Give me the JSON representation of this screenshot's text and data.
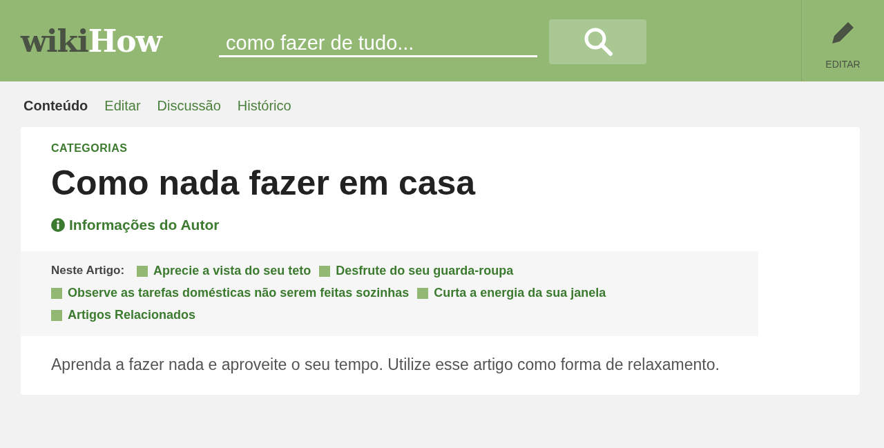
{
  "header": {
    "logo": {
      "part_1": "wiki",
      "part_2": "How"
    },
    "search": {
      "placeholder": "como fazer de tudo..."
    },
    "edit_button": {
      "label": "EDITAR"
    }
  },
  "tabs": [
    {
      "label": "Conteúdo",
      "selected": true
    },
    {
      "label": "Editar",
      "selected": false
    },
    {
      "label": "Discussão",
      "selected": false
    },
    {
      "label": "Histórico",
      "selected": false
    }
  ],
  "article": {
    "breadcrumb": "CATEGORIAS",
    "title": "Como nada fazer em casa",
    "author_info": "Informações do Autor",
    "toc": {
      "label": "Neste Artigo:",
      "items": [
        "Aprecie a vista do seu teto",
        "Desfrute do seu guarda-roupa",
        "Observe as tarefas domésticas não serem feitas sozinhas",
        "Curta a energia da sua janela",
        "Artigos Relacionados"
      ]
    },
    "intro": "Aprenda a fazer nada e aproveite o seu tempo. Utilize esse artigo como forma de relaxamento."
  }
}
